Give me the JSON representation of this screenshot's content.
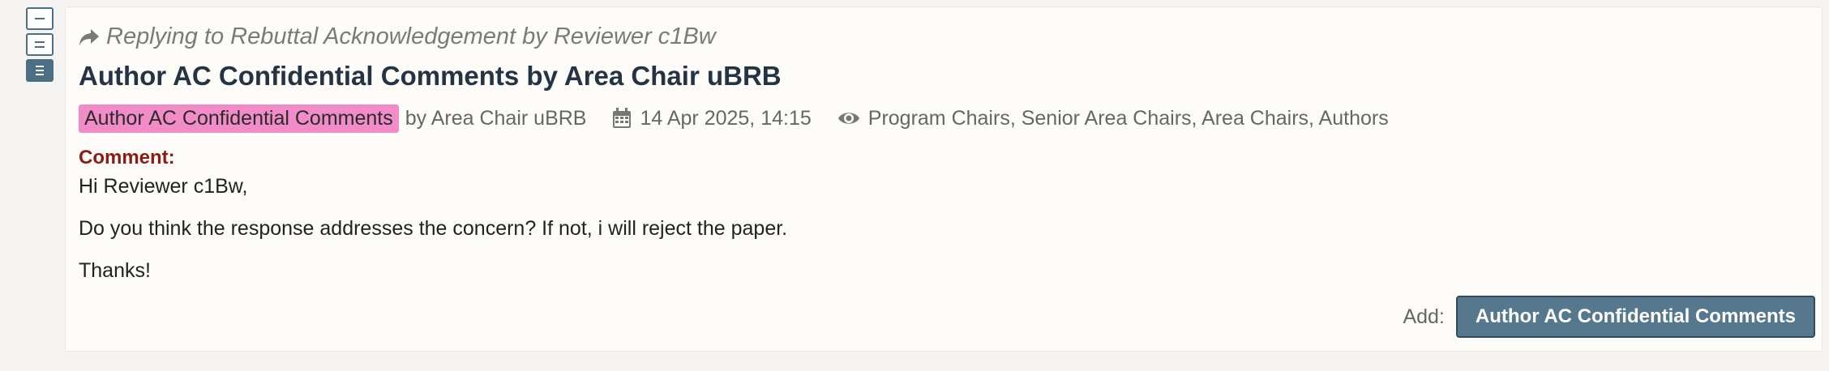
{
  "view_controls": [
    {
      "icon": "collapse-icon",
      "active": false
    },
    {
      "icon": "default-view-icon",
      "active": false
    },
    {
      "icon": "expanded-view-icon",
      "active": true
    }
  ],
  "note": {
    "reply_to_text": "Replying to Rebuttal Acknowledgement by Reviewer c1Bw",
    "title": "Author AC Confidential Comments by Area Chair uBRB",
    "invitation_badge": "Author AC Confidential Comments",
    "signature": "by Area Chair uBRB",
    "date": "14 Apr 2025, 14:15",
    "readers": "Program Chairs, Senior Area Chairs, Area Chairs, Authors",
    "field_label": "Comment:",
    "comment_paragraphs": [
      "Hi Reviewer c1Bw,",
      "Do you think the response addresses the concern? If not, i will reject the paper.",
      "Thanks!"
    ],
    "add_label": "Add:",
    "add_button_label": "Author AC Confidential Comments"
  },
  "colors": {
    "page_background": "#f4f3f1",
    "card_background": "#fdfcf9",
    "badge": "#f28cc8",
    "title": "#243444",
    "field_label": "#8c1b13",
    "button": "#56788f"
  }
}
